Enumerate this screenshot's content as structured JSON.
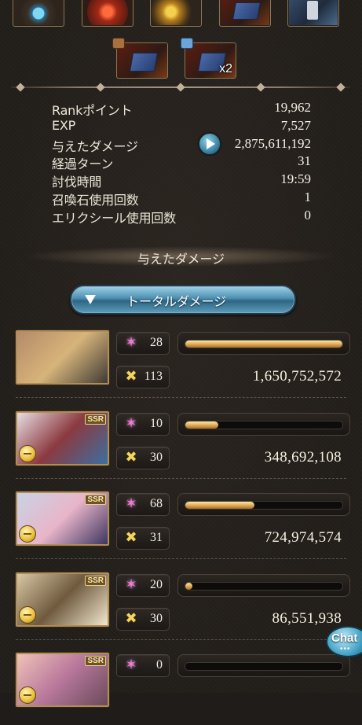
{
  "rewards": {
    "top_row": [
      {
        "name": "orb",
        "icon": "blue-orb-icon"
      },
      {
        "name": "chest",
        "icon": "red-chest-icon"
      },
      {
        "name": "drops",
        "icon": "gold-drops-icon"
      },
      {
        "name": "book",
        "icon": "blue-book-icon"
      },
      {
        "name": "hammer",
        "icon": "hammer-icon"
      }
    ],
    "second_row": [
      {
        "icon": "blue-book-icon",
        "chest": "red-chest-icon",
        "count": ""
      },
      {
        "icon": "blue-book-icon",
        "chest": "blue-chest-icon",
        "count": "x2"
      }
    ]
  },
  "stats": [
    {
      "label": "Rankポイント",
      "value": "19,962"
    },
    {
      "label": "EXP",
      "value": "7,527"
    },
    {
      "label": "与えたダメージ",
      "value": "2,875,611,192"
    },
    {
      "label": "経過ターン",
      "value": "31"
    },
    {
      "label": "討伐時間",
      "value": "19:59"
    },
    {
      "label": "召喚石使用回数",
      "value": "1"
    },
    {
      "label": "エリクシール使用回数",
      "value": "0"
    }
  ],
  "damage_section": {
    "title": "与えたダメージ",
    "selector_label": "トータルダメージ"
  },
  "party": [
    {
      "star_count": "28",
      "ca_count": "113",
      "damage": "1,650,752,572",
      "gauge": 1.0,
      "rarity": "",
      "colors": [
        "#b58a6a",
        "#d7b47a",
        "#3f3a36"
      ]
    },
    {
      "star_count": "10",
      "ca_count": "30",
      "damage": "348,692,108",
      "gauge": 0.21,
      "rarity": "SSR",
      "colors": [
        "#e7dde2",
        "#8b3a40",
        "#3c6fa0"
      ]
    },
    {
      "star_count": "68",
      "ca_count": "31",
      "damage": "724,974,574",
      "gauge": 0.44,
      "rarity": "SSR",
      "colors": [
        "#c9d3e5",
        "#e9b5c9",
        "#3d3560"
      ]
    },
    {
      "star_count": "20",
      "ca_count": "30",
      "damage": "86,551,938",
      "gauge": 0.03,
      "rarity": "SSR",
      "colors": [
        "#d8c6a4",
        "#6f5a3e",
        "#f1e7cf"
      ]
    },
    {
      "star_count": "0",
      "ca_count": "",
      "damage": "",
      "gauge": 0.0,
      "rarity": "SSR",
      "colors": [
        "#f0c2b8",
        "#b7779b",
        "#6a4a5a"
      ]
    }
  ],
  "chat": {
    "label": "Chat",
    "dots": "•••"
  },
  "colors": {
    "accent_gold": "#d9a24c",
    "button_blue": "#4d8fb0",
    "star_pink": "#f179d2"
  }
}
